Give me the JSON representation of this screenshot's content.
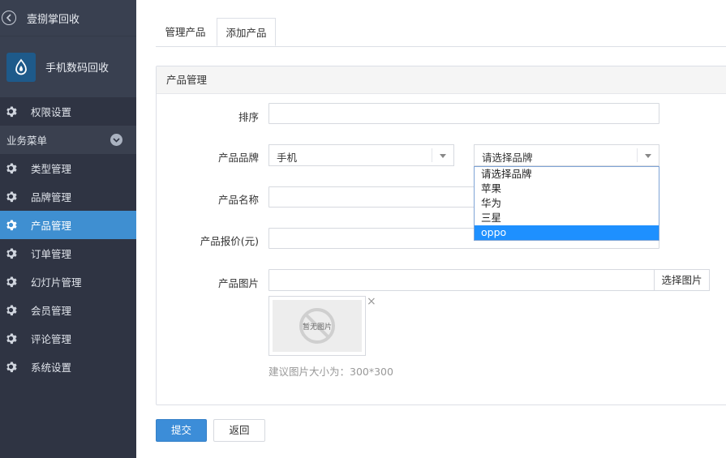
{
  "sidebar": {
    "app_title": "壹捌掌回收",
    "account_name": "手机数码回收",
    "permission_item": "权限设置",
    "group_label": "业务菜单",
    "items": [
      {
        "label": "类型管理",
        "icon": "gear-icon"
      },
      {
        "label": "品牌管理",
        "icon": "gear-icon"
      },
      {
        "label": "产品管理",
        "icon": "gear-icon",
        "active": true
      },
      {
        "label": "订单管理",
        "icon": "gear-icon"
      },
      {
        "label": "幻灯片管理",
        "icon": "gear-icon"
      },
      {
        "label": "会员管理",
        "icon": "gear-icon"
      },
      {
        "label": "评论管理",
        "icon": "gear-icon"
      },
      {
        "label": "系统设置",
        "icon": "gear-icon"
      }
    ],
    "active_color": "#3f8fd1"
  },
  "tabs": [
    {
      "label": "管理产品"
    },
    {
      "label": "添加产品",
      "active": true
    }
  ],
  "panel": {
    "title": "产品管理",
    "fields": {
      "sort_label": "排序",
      "sort_value": "",
      "brand_label": "产品品牌",
      "category_selected": "手机",
      "brand_selected": "请选择品牌",
      "brand_options": [
        "请选择品牌",
        "苹果",
        "华为",
        "三星",
        "oppo"
      ],
      "brand_highlighted": "oppo",
      "name_label": "产品名称",
      "name_value": "",
      "price_label": "产品报价(元)",
      "price_value": "",
      "image_label": "产品图片",
      "image_value": "",
      "pick_image_button": "选择图片",
      "no_image_text": "暂无图片",
      "close_symbol": "×",
      "hint": "建议图片大小为：300*300"
    }
  },
  "actions": {
    "submit": "提交",
    "back": "返回"
  },
  "colors": {
    "primary": "#3c8dd8",
    "sidebar_bg": "#2f3443",
    "dropdown_highlight": "#1e90ff"
  }
}
